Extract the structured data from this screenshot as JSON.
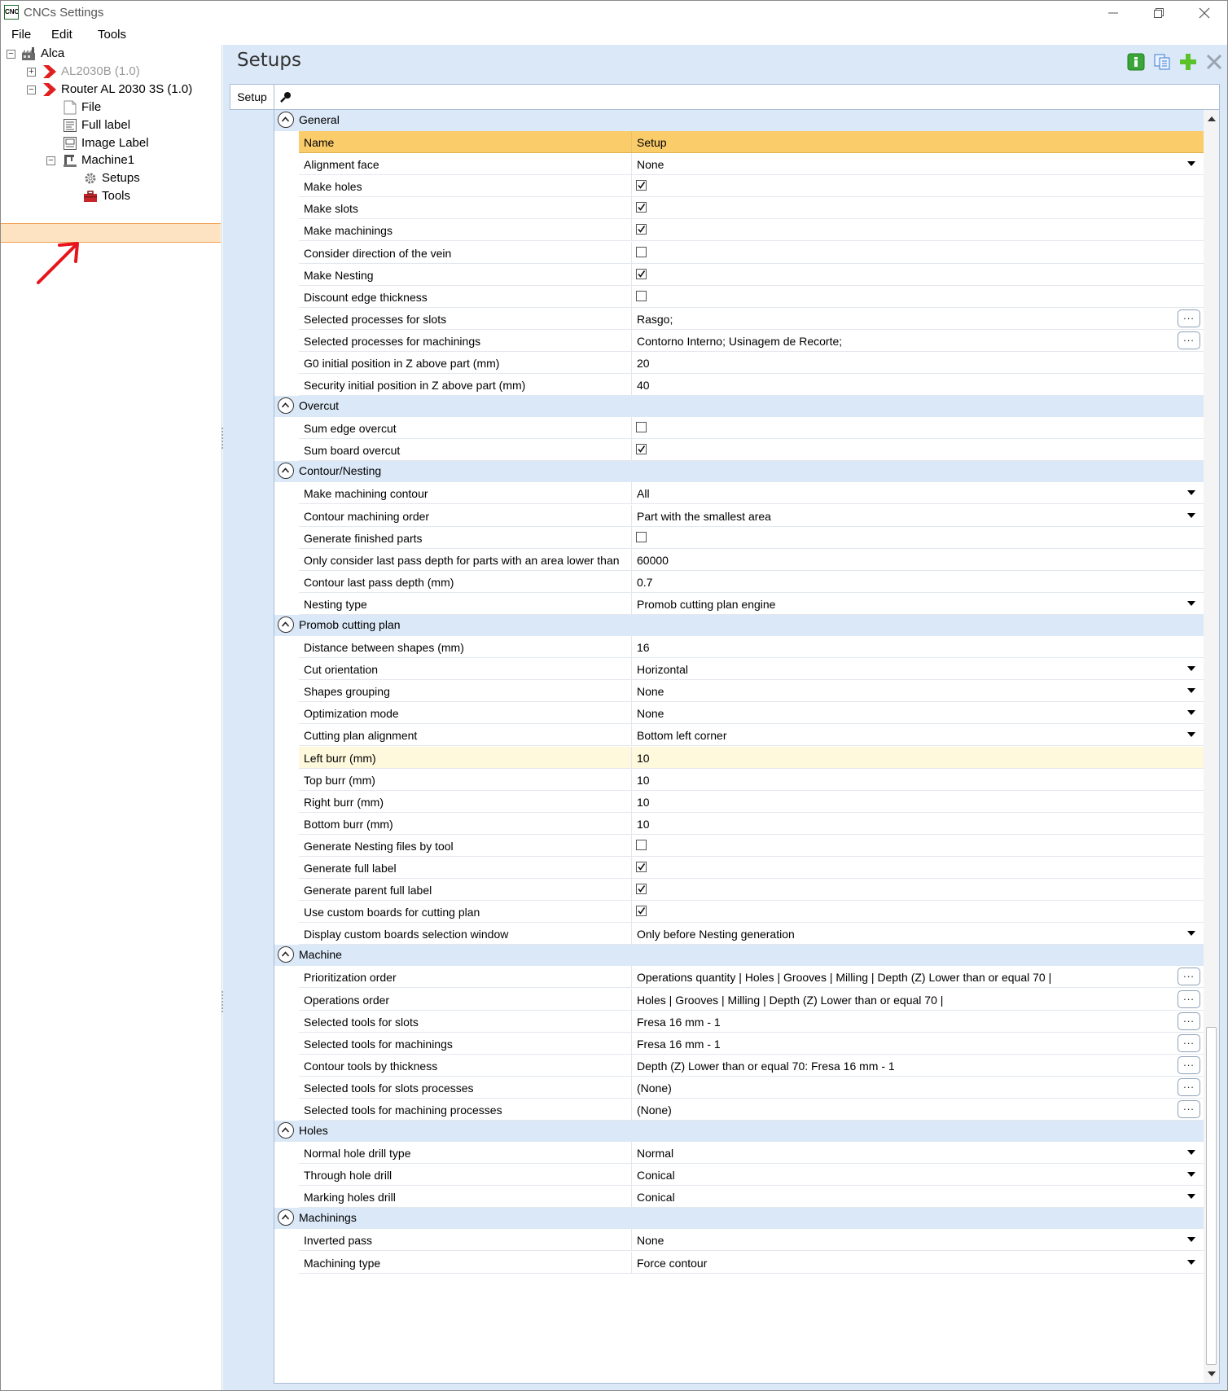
{
  "window": {
    "title": "CNCs Settings",
    "icon_text": "CNC",
    "controls": [
      "minimize",
      "restore",
      "close"
    ]
  },
  "menu": [
    "File",
    "Edit",
    "Tools"
  ],
  "tree": {
    "root": "Alca",
    "machine_disabled": "AL2030B (1.0)",
    "machine_active": "Router AL 2030 3S (1.0)",
    "file": "File",
    "full_label": "Full label",
    "image_label": "Image Label",
    "machine1": "Machine1",
    "setups": "Setups",
    "tools": "Tools"
  },
  "panel": {
    "title": "Setups",
    "tab": "Setup",
    "search_value": "",
    "toolbar": [
      "info-icon",
      "copy-icon",
      "add-icon",
      "delete-icon"
    ]
  },
  "header": {
    "name": "Name",
    "setup": "Setup"
  },
  "categories": [
    {
      "title": "General",
      "rows": [
        {
          "name": "Alignment face",
          "kind": "dropdown",
          "value": "None"
        },
        {
          "name": "Make holes",
          "kind": "check",
          "checked": true
        },
        {
          "name": "Make slots",
          "kind": "check",
          "checked": true
        },
        {
          "name": "Make machinings",
          "kind": "check",
          "checked": true
        },
        {
          "name": "Consider direction of the vein",
          "kind": "check",
          "checked": false
        },
        {
          "name": "Make Nesting",
          "kind": "check",
          "checked": true
        },
        {
          "name": "Discount edge thickness",
          "kind": "check",
          "checked": false
        },
        {
          "name": "Selected processes for slots",
          "kind": "ellipsis",
          "value": "Rasgo;"
        },
        {
          "name": "Selected processes for machinings",
          "kind": "ellipsis",
          "value": "Contorno Interno; Usinagem de Recorte;"
        },
        {
          "name": "G0 initial position in Z above part (mm)",
          "kind": "text",
          "value": "20"
        },
        {
          "name": "Security initial position in Z above part (mm)",
          "kind": "text",
          "value": "40"
        }
      ]
    },
    {
      "title": "Overcut",
      "rows": [
        {
          "name": "Sum edge overcut",
          "kind": "check",
          "checked": false
        },
        {
          "name": "Sum board overcut",
          "kind": "check",
          "checked": true
        }
      ]
    },
    {
      "title": "Contour/Nesting",
      "rows": [
        {
          "name": "Make machining contour",
          "kind": "dropdown",
          "value": "All"
        },
        {
          "name": "Contour machining order",
          "kind": "dropdown",
          "value": "Part with the smallest area"
        },
        {
          "name": "Generate finished parts",
          "kind": "check",
          "checked": false
        },
        {
          "name": "Only consider last pass depth for parts with an area lower than",
          "kind": "text",
          "value": "60000"
        },
        {
          "name": "Contour last pass depth (mm)",
          "kind": "text",
          "value": "0.7"
        },
        {
          "name": "Nesting type",
          "kind": "dropdown",
          "value": "Promob cutting plan engine"
        }
      ]
    },
    {
      "title": "Promob cutting plan",
      "rows": [
        {
          "name": "Distance between shapes (mm)",
          "kind": "text",
          "value": "16"
        },
        {
          "name": "Cut orientation",
          "kind": "dropdown",
          "value": "Horizontal"
        },
        {
          "name": "Shapes grouping",
          "kind": "dropdown",
          "value": "None"
        },
        {
          "name": "Optimization mode",
          "kind": "dropdown",
          "value": "None"
        },
        {
          "name": "Cutting plan alignment",
          "kind": "dropdown",
          "value": "Bottom left corner"
        },
        {
          "name": "Left burr (mm)",
          "kind": "text",
          "value": "10",
          "highlight": true
        },
        {
          "name": "Top burr (mm)",
          "kind": "text",
          "value": "10"
        },
        {
          "name": "Right burr (mm)",
          "kind": "text",
          "value": "10"
        },
        {
          "name": "Bottom burr (mm)",
          "kind": "text",
          "value": "10"
        },
        {
          "name": "Generate Nesting files by tool",
          "kind": "check",
          "checked": false
        },
        {
          "name": "Generate full label",
          "kind": "check",
          "checked": true
        },
        {
          "name": "Generate parent full label",
          "kind": "check",
          "checked": true
        },
        {
          "name": "Use custom boards for cutting plan",
          "kind": "check",
          "checked": true
        },
        {
          "name": "Display custom boards selection window",
          "kind": "dropdown",
          "value": "Only before Nesting generation"
        }
      ]
    },
    {
      "title": "Machine",
      "rows": [
        {
          "name": "Prioritization order",
          "kind": "ellipsis",
          "value": "Operations quantity | Holes | Grooves | Milling | Depth (Z) Lower than or equal 70 |"
        },
        {
          "name": "Operations order",
          "kind": "ellipsis",
          "value": "Holes | Grooves | Milling | Depth (Z) Lower than or equal 70 |"
        },
        {
          "name": "Selected tools for slots",
          "kind": "ellipsis",
          "value": "Fresa 16 mm - 1"
        },
        {
          "name": "Selected tools for machinings",
          "kind": "ellipsis",
          "value": "Fresa 16 mm - 1"
        },
        {
          "name": "Contour tools by thickness",
          "kind": "ellipsis",
          "value": "Depth (Z) Lower than or equal 70: Fresa 16 mm - 1"
        },
        {
          "name": "Selected tools for slots processes",
          "kind": "ellipsis",
          "value": "(None)"
        },
        {
          "name": "Selected tools for machining processes",
          "kind": "ellipsis",
          "value": "(None)"
        }
      ]
    },
    {
      "title": "Holes",
      "rows": [
        {
          "name": "Normal hole drill type",
          "kind": "dropdown",
          "value": "Normal"
        },
        {
          "name": "Through hole drill",
          "kind": "dropdown",
          "value": "Conical"
        },
        {
          "name": "Marking holes drill",
          "kind": "dropdown",
          "value": "Conical"
        }
      ]
    },
    {
      "title": "Machinings",
      "rows": [
        {
          "name": "Inverted pass",
          "kind": "dropdown",
          "value": "None"
        },
        {
          "name": "Machining type",
          "kind": "dropdown",
          "value": "Force contour"
        }
      ]
    }
  ],
  "colors": {
    "accent_header": "#fbcc6a",
    "selection": "#fde3c2",
    "panel_bg": "#dbe8f7",
    "highlight_row": "#fef8dd"
  }
}
